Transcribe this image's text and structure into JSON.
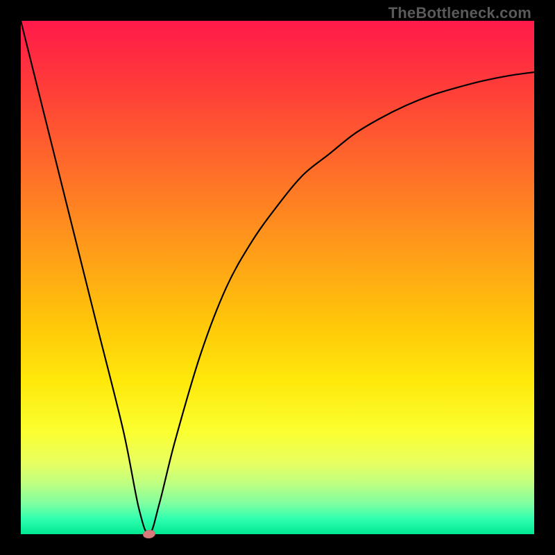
{
  "watermark": {
    "text": "TheBottleneck.com"
  },
  "chart_data": {
    "type": "line",
    "title": "",
    "xlabel": "",
    "ylabel": "",
    "xlim": [
      0,
      100
    ],
    "ylim": [
      0,
      100
    ],
    "grid": false,
    "legend": false,
    "background": "red-yellow-green vertical gradient (bottleneck severity)",
    "series": [
      {
        "name": "bottleneck-curve",
        "x": [
          0,
          5,
          10,
          15,
          20,
          23,
          25,
          27,
          30,
          35,
          40,
          45,
          50,
          55,
          60,
          65,
          70,
          75,
          80,
          85,
          90,
          95,
          100
        ],
        "y": [
          100,
          80,
          60,
          40,
          20,
          5,
          0,
          6,
          18,
          35,
          48,
          57,
          64,
          70,
          74,
          78,
          81,
          83.5,
          85.5,
          87,
          88.3,
          89.3,
          90
        ]
      }
    ],
    "marker": {
      "x": 25,
      "y": 0,
      "shape": "ellipse",
      "color": "#d97a7a"
    }
  }
}
